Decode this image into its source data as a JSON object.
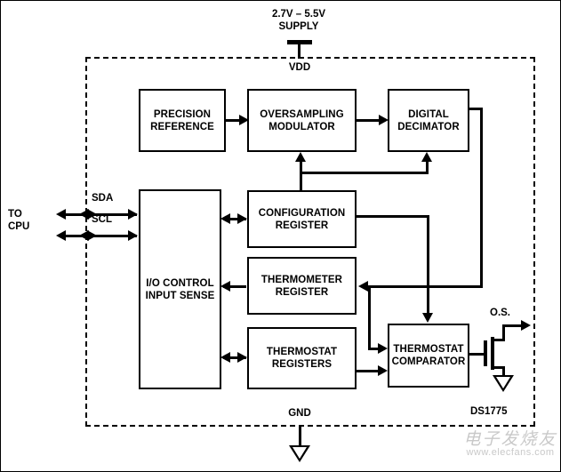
{
  "diagram": {
    "part_number": "DS1775",
    "supply_label": "2.7V – 5.5V\nSUPPLY",
    "vdd_label": "VDD",
    "gnd_label": "GND",
    "cpu_label": "TO\nCPU",
    "sda_label": "SDA",
    "scl_label": "SCL",
    "os_label": "O.S.",
    "blocks": [
      {
        "id": "precision-reference",
        "label": "PRECISION\nREFERENCE"
      },
      {
        "id": "oversampling-modulator",
        "label": "OVERSAMPLING\nMODULATOR"
      },
      {
        "id": "digital-decimator",
        "label": "DIGITAL\nDECIMATOR"
      },
      {
        "id": "io-control-input-sense",
        "label": "I/O CONTROL\nINPUT SENSE"
      },
      {
        "id": "configuration-register",
        "label": "CONFIGURATION\nREGISTER"
      },
      {
        "id": "thermometer-register",
        "label": "THERMOMETER\nREGISTER"
      },
      {
        "id": "thermostat-registers",
        "label": "THERMOSTAT\nREGISTERS"
      },
      {
        "id": "thermostat-comparator",
        "label": "THERMOSTAT\nCOMPARATOR"
      }
    ],
    "watermark": {
      "text_cn": "电子发烧友",
      "url": "www.elecfans.com"
    },
    "colors": {
      "ink": "#000000",
      "background": "#ffffff",
      "watermark": "#c9c9c9"
    }
  }
}
